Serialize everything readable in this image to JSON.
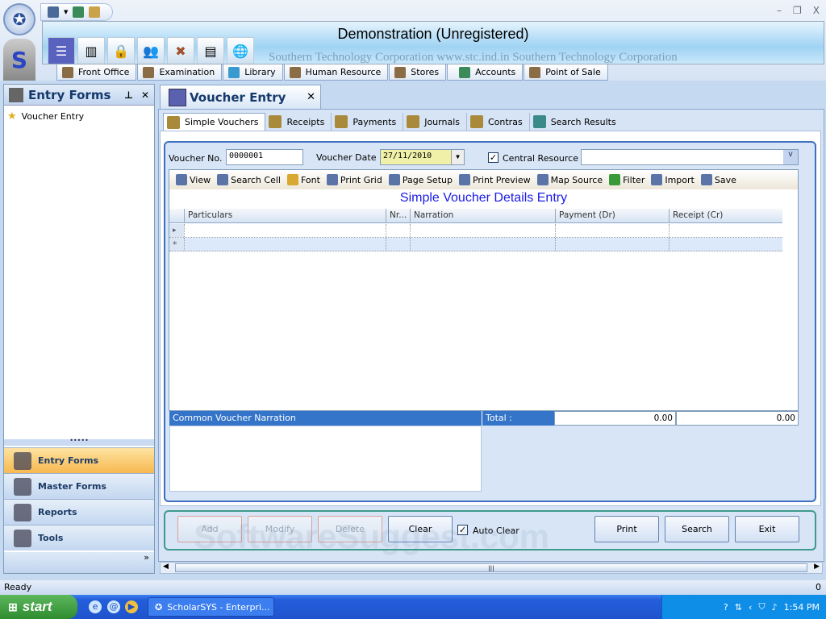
{
  "quick_access": {
    "title_controls": [
      "–",
      "❐",
      "X"
    ]
  },
  "banner": {
    "title": "Demonstration (Unregistered)",
    "watermark": "Southern Technology Corporation www.stc.ind.in   Southern Technology Corporation"
  },
  "module_tabs": [
    "Front Office",
    "Examination",
    "Library",
    "Human Resource",
    "Stores",
    "Accounts",
    "Point of Sale"
  ],
  "left_panel": {
    "title": "Entry Forms",
    "pin": "⊥",
    "close": "✕",
    "items": [
      "Voucher Entry"
    ],
    "splitter": "•••••",
    "nav": [
      "Entry Forms",
      "Master Forms",
      "Reports",
      "Tools"
    ],
    "more": "»"
  },
  "doc_tab": {
    "title": "Voucher Entry",
    "close": "✕"
  },
  "sub_tabs": [
    "Simple Vouchers",
    "Receipts",
    "Payments",
    "Journals",
    "Contras",
    "Search Results"
  ],
  "form": {
    "voucher_no_label": "Voucher No.",
    "voucher_no": "0000001",
    "voucher_date_label": "Voucher Date",
    "voucher_date": "27/11/2010",
    "central_resource_label": "Central Resource",
    "central_resource_checked": "✓",
    "central_resource_value": "",
    "dropdown_arrow": "v"
  },
  "grid": {
    "toolbar": [
      "View",
      "Search Cell",
      "Font",
      "Print Grid",
      "Page Setup",
      "Print Preview",
      "Map Source",
      "Filter",
      "Import",
      "Save"
    ],
    "title": "Simple Voucher Details Entry",
    "columns": [
      "Particulars",
      "Nr...",
      "Narration",
      "Payment (Dr)",
      "Receipt (Cr)"
    ],
    "row_markers": [
      "▸",
      "*"
    ]
  },
  "footer": {
    "narration_label": "Common Voucher Narration",
    "total_label": "Total :",
    "total_payment": "0.00",
    "total_receipt": "0.00"
  },
  "buttons": {
    "add": "Add",
    "modify": "Modify",
    "delete": "Delete",
    "clear": "Clear",
    "auto_clear": "Auto Clear",
    "auto_clear_checked": "✓",
    "print": "Print",
    "search": "Search",
    "exit": "Exit"
  },
  "scrollbar": {
    "grip": "|||"
  },
  "status": {
    "text": "Ready",
    "right": "0"
  },
  "taskbar": {
    "start": "start",
    "task": "ScholarSYS - Enterpri...",
    "time": "1:54 PM"
  },
  "watermark": "SoftwareSuggest.com"
}
